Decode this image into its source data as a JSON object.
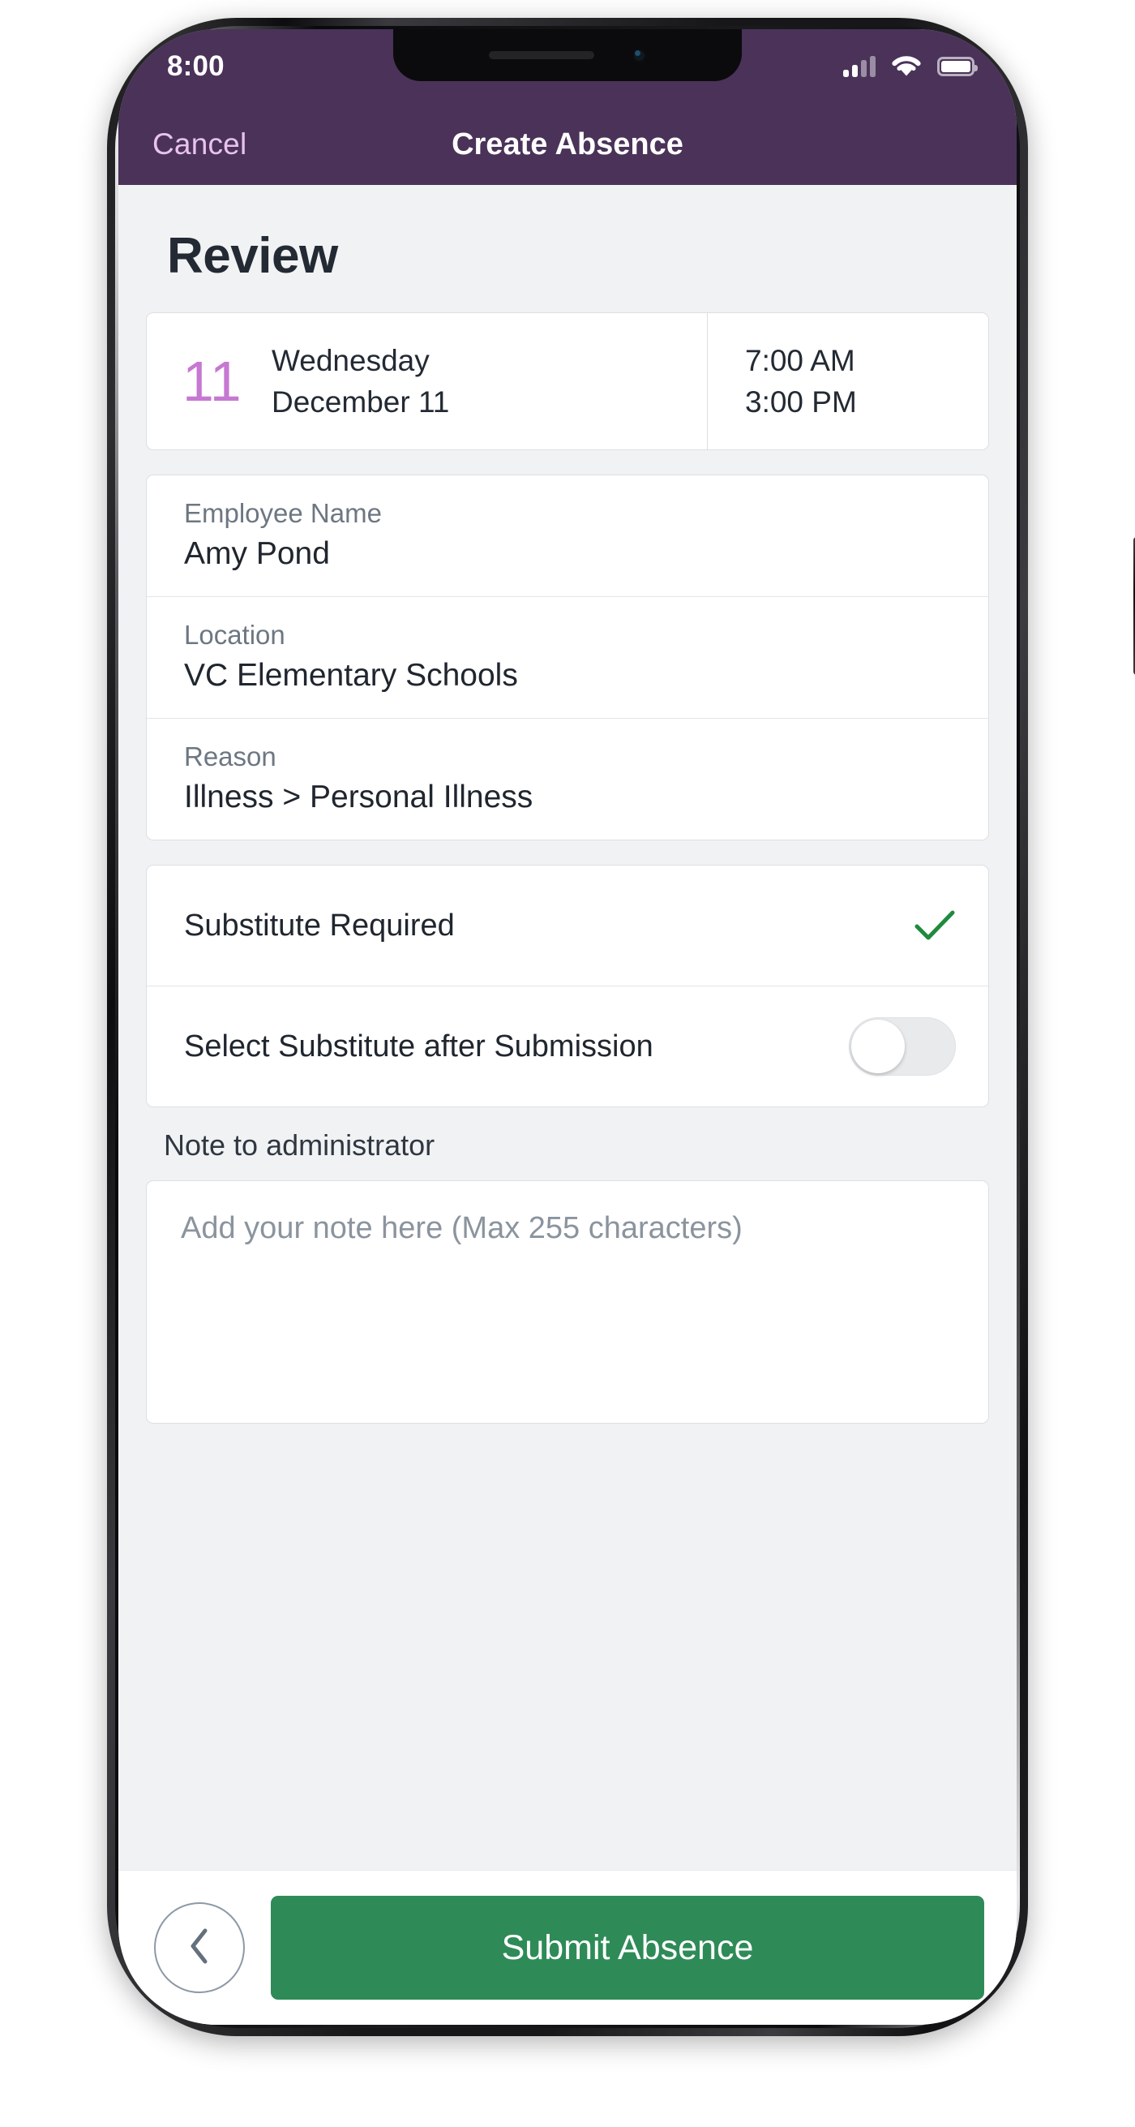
{
  "status_bar": {
    "time": "8:00",
    "signal_icon": "cellular-signal-icon",
    "wifi_icon": "wifi-icon",
    "battery_icon": "battery-full-icon"
  },
  "nav": {
    "cancel_label": "Cancel",
    "title": "Create Absence"
  },
  "page": {
    "heading": "Review"
  },
  "date_card": {
    "day_number": "11",
    "weekday": "Wednesday",
    "date": "December 11",
    "start_time": "7:00 AM",
    "end_time": "3:00 PM"
  },
  "details": [
    {
      "label": "Employee Name",
      "value": "Amy Pond"
    },
    {
      "label": "Location",
      "value": "VC Elementary Schools"
    },
    {
      "label": "Reason",
      "value": "Illness > Personal Illness"
    }
  ],
  "substitute": {
    "required_label": "Substitute Required",
    "required_checked": true,
    "check_icon": "check-icon",
    "select_after_label": "Select Substitute after Submission",
    "select_after_enabled": false
  },
  "note": {
    "label": "Note to administrator",
    "placeholder": "Add your note here (Max 255 characters)",
    "value": ""
  },
  "footer": {
    "back_icon": "chevron-left-icon",
    "submit_label": "Submit Absence"
  },
  "colors": {
    "header_purple": "#4a3259",
    "cancel_pink": "#e9c2ee",
    "day_number_purple": "#c778d2",
    "submit_green": "#2e8b57",
    "check_green": "#1f8a3e",
    "screen_bg": "#f1f2f4"
  }
}
